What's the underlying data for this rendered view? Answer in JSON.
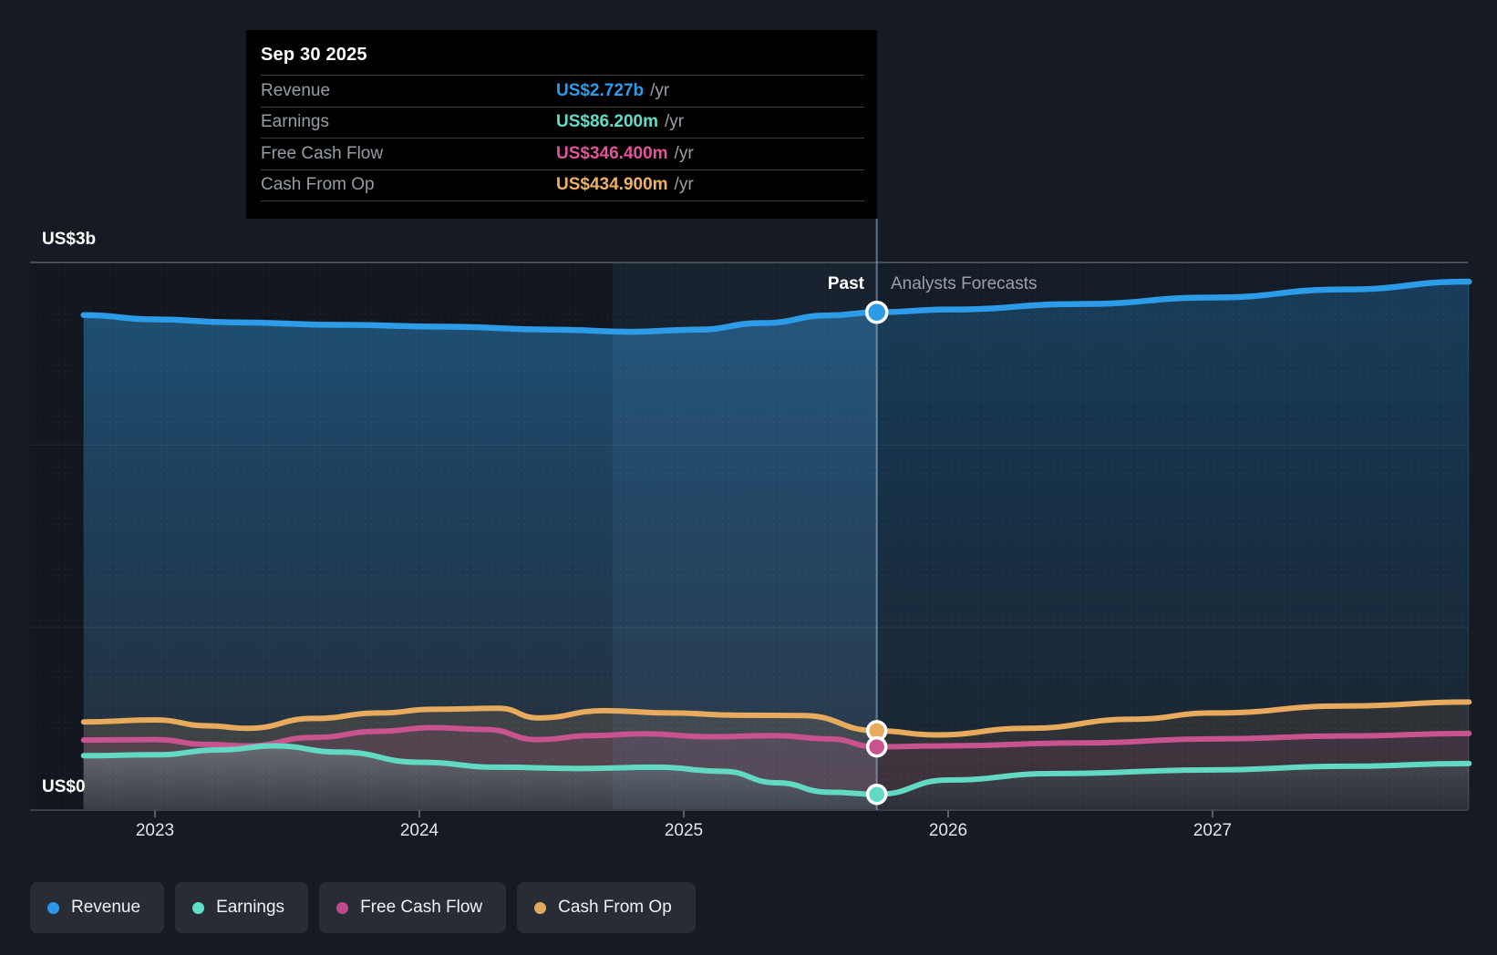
{
  "tooltip": {
    "date": "Sep 30 2025",
    "rows": [
      {
        "label": "Revenue",
        "value": "US$2.727b",
        "suffix": "/yr",
        "color": "#2d9ce8"
      },
      {
        "label": "Earnings",
        "value": "US$86.200m",
        "suffix": "/yr",
        "color": "#63dcc5"
      },
      {
        "label": "Free Cash Flow",
        "value": "US$346.400m",
        "suffix": "/yr",
        "color": "#e0549b"
      },
      {
        "label": "Cash From Op",
        "value": "US$434.900m",
        "suffix": "/yr",
        "color": "#edb161"
      }
    ]
  },
  "annotations": {
    "past": "Past",
    "forecast": "Analysts Forecasts"
  },
  "legend": [
    {
      "label": "Revenue",
      "color": "#2d96e8"
    },
    {
      "label": "Earnings",
      "color": "#5fdfc5"
    },
    {
      "label": "Free Cash Flow",
      "color": "#c0498b"
    },
    {
      "label": "Cash From Op",
      "color": "#e2a95f"
    }
  ],
  "chart_data": {
    "type": "area",
    "currency": "USD",
    "unit": "US$m",
    "y_ticks": [
      {
        "label": "US$3b",
        "value_m": 3000
      },
      {
        "label": "US$0",
        "value_m": 0
      }
    ],
    "x_ticks": [
      {
        "label": "2023",
        "t": 2023
      },
      {
        "label": "2024",
        "t": 2024
      },
      {
        "label": "2025",
        "t": 2025
      },
      {
        "label": "2026",
        "t": 2026
      },
      {
        "label": "2027",
        "t": 2027
      }
    ],
    "x_range": [
      2022.73,
      2027.97
    ],
    "ylim_m": [
      0,
      3000
    ],
    "grid": "horizontal",
    "divider_t": 2025.73,
    "divider_date": "Sep 30 2025",
    "highlight_band": [
      2024.73,
      2025.73
    ],
    "legend_position": "bottom-left",
    "series": [
      {
        "name": "Revenue",
        "color": "#2d9ce8",
        "points": [
          [
            2022.73,
            2712
          ],
          [
            2023.0,
            2688
          ],
          [
            2023.3,
            2672
          ],
          [
            2023.7,
            2658
          ],
          [
            2024.1,
            2648
          ],
          [
            2024.5,
            2632
          ],
          [
            2024.8,
            2620
          ],
          [
            2025.05,
            2632
          ],
          [
            2025.3,
            2668
          ],
          [
            2025.55,
            2710
          ],
          [
            2025.73,
            2727
          ],
          [
            2026.0,
            2742
          ],
          [
            2026.5,
            2772
          ],
          [
            2027.0,
            2808
          ],
          [
            2027.5,
            2852
          ],
          [
            2027.97,
            2895
          ]
        ]
      },
      {
        "name": "Cash From Op",
        "color": "#e8aa5c",
        "points": [
          [
            2022.73,
            483
          ],
          [
            2023.0,
            494
          ],
          [
            2023.2,
            462
          ],
          [
            2023.35,
            448
          ],
          [
            2023.6,
            502
          ],
          [
            2023.85,
            532
          ],
          [
            2024.05,
            552
          ],
          [
            2024.3,
            558
          ],
          [
            2024.45,
            505
          ],
          [
            2024.7,
            545
          ],
          [
            2024.95,
            532
          ],
          [
            2025.2,
            520
          ],
          [
            2025.45,
            518
          ],
          [
            2025.73,
            434.9
          ],
          [
            2025.95,
            412
          ],
          [
            2026.3,
            448
          ],
          [
            2026.7,
            498
          ],
          [
            2027.0,
            532
          ],
          [
            2027.5,
            570
          ],
          [
            2027.97,
            592
          ]
        ]
      },
      {
        "name": "Free Cash Flow",
        "color": "#c9538f",
        "points": [
          [
            2022.73,
            384
          ],
          [
            2023.0,
            386
          ],
          [
            2023.2,
            360
          ],
          [
            2023.35,
            352
          ],
          [
            2023.6,
            398
          ],
          [
            2023.85,
            432
          ],
          [
            2024.05,
            452
          ],
          [
            2024.25,
            442
          ],
          [
            2024.45,
            386
          ],
          [
            2024.65,
            408
          ],
          [
            2024.85,
            418
          ],
          [
            2025.1,
            402
          ],
          [
            2025.35,
            408
          ],
          [
            2025.55,
            390
          ],
          [
            2025.73,
            346.4
          ],
          [
            2026.0,
            352
          ],
          [
            2026.5,
            368
          ],
          [
            2027.0,
            390
          ],
          [
            2027.5,
            406
          ],
          [
            2027.97,
            420
          ]
        ]
      },
      {
        "name": "Earnings",
        "color": "#62d9c2",
        "points": [
          [
            2022.73,
            298
          ],
          [
            2023.0,
            303
          ],
          [
            2023.25,
            330
          ],
          [
            2023.45,
            352
          ],
          [
            2023.7,
            318
          ],
          [
            2024.0,
            262
          ],
          [
            2024.3,
            235
          ],
          [
            2024.6,
            228
          ],
          [
            2024.9,
            235
          ],
          [
            2025.15,
            212
          ],
          [
            2025.35,
            150
          ],
          [
            2025.55,
            98
          ],
          [
            2025.73,
            86.2
          ],
          [
            2026.0,
            165
          ],
          [
            2026.4,
            200
          ],
          [
            2027.0,
            220
          ],
          [
            2027.5,
            240
          ],
          [
            2027.97,
            255
          ]
        ]
      }
    ],
    "markers": [
      {
        "series": "Revenue",
        "t": 2025.73,
        "value_m": 2727
      },
      {
        "series": "Cash From Op",
        "t": 2025.73,
        "value_m": 434.9
      },
      {
        "series": "Free Cash Flow",
        "t": 2025.73,
        "value_m": 346.4
      },
      {
        "series": "Earnings",
        "t": 2025.73,
        "value_m": 86.2
      }
    ]
  }
}
